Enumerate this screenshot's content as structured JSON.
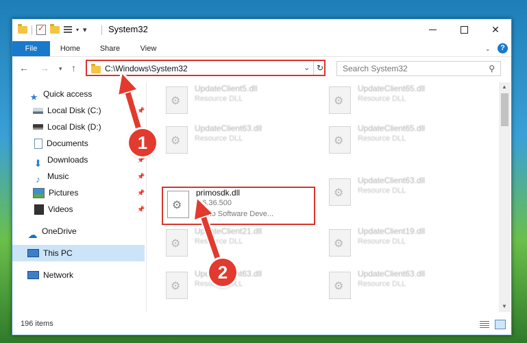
{
  "window": {
    "title": "System32",
    "controls": {
      "minimize": "—",
      "maximize": "□",
      "close": "✕"
    }
  },
  "ribbon": {
    "tabs": [
      {
        "label": "File",
        "active": true
      },
      {
        "label": "Home"
      },
      {
        "label": "Share"
      },
      {
        "label": "View"
      }
    ],
    "help": "?"
  },
  "navigation": {
    "back": "←",
    "forward": "→",
    "up": "↑",
    "address": "C:\\Windows\\System32",
    "search_placeholder": "Search System32"
  },
  "sidebar": {
    "items": [
      {
        "label": "Quick access",
        "icon": "star-icon"
      },
      {
        "label": "Local Disk (C:)",
        "icon": "drive-icon",
        "pinned": true
      },
      {
        "label": "Local Disk (D:)",
        "icon": "drive-icon"
      },
      {
        "label": "Documents",
        "icon": "documents-icon",
        "pinned": true
      },
      {
        "label": "Downloads",
        "icon": "downloads-icon",
        "pinned": true
      },
      {
        "label": "Music",
        "icon": "music-icon",
        "pinned": true
      },
      {
        "label": "Pictures",
        "icon": "pictures-icon",
        "pinned": true
      },
      {
        "label": "Videos",
        "icon": "videos-icon",
        "pinned": true
      },
      {
        "label": "OneDrive",
        "icon": "onedrive-icon"
      },
      {
        "label": "This PC",
        "icon": "this-pc-icon",
        "selected": true
      },
      {
        "label": "Network",
        "icon": "network-icon"
      }
    ]
  },
  "files": {
    "column1": [
      {
        "name": "UpdateClient5.dll",
        "desc": "Resource DLL"
      },
      {
        "name": "UpdateClient63.dll",
        "desc": "Resource DLL"
      },
      {
        "name": "primosdk.dll",
        "version": "3.6.36.500",
        "desc": "Primo Software Deve...",
        "selected": true
      },
      {
        "name": "UpdateClient21.dll",
        "desc": "Resource DLL"
      },
      {
        "name": "UpdateClient63.dll",
        "desc": "Resource DLL"
      }
    ],
    "column2": [
      {
        "name": "UpdateClient65.dll",
        "desc": "Resource DLL"
      },
      {
        "name": "UpdateClient65.dll",
        "desc": "Resource DLL"
      },
      {
        "name": "UpdateClient63.dll",
        "desc": "Resource DLL"
      },
      {
        "name": "UpdateClient19.dll",
        "desc": "Resource DLL"
      },
      {
        "name": "UpdateClient63.dll",
        "desc": "Resource DLL"
      }
    ]
  },
  "status": {
    "item_count": "196 items"
  },
  "annotations": {
    "step1": "1",
    "step2": "2",
    "color": "#e23a2e"
  }
}
